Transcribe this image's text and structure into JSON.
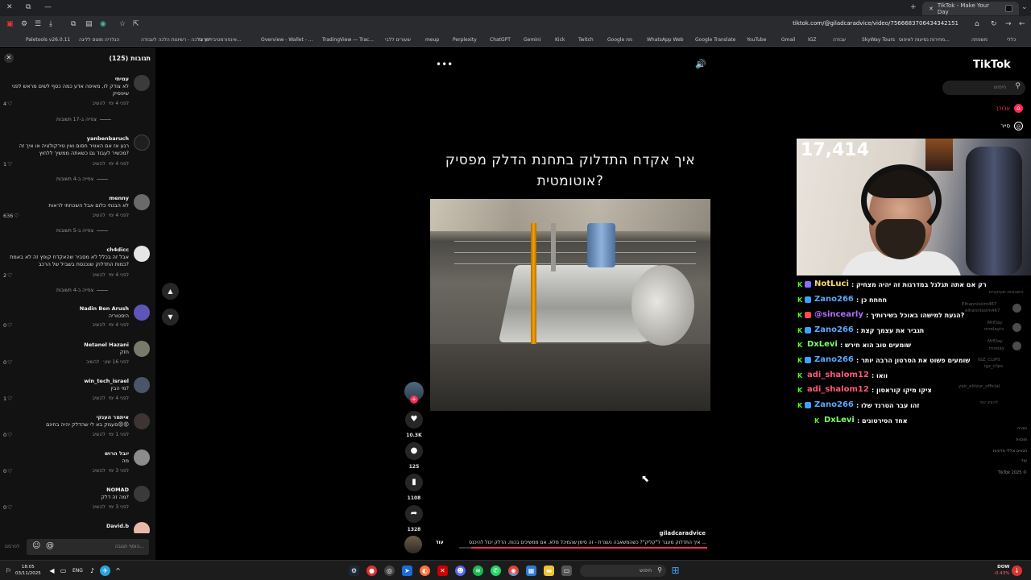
{
  "browser": {
    "tab_title": "TikTok - Make Your Day",
    "url": "tiktok.com/@giladcaradvice/video/7566683706434342151",
    "bookmarks": [
      "Paletools v26.0.11",
      "הגלריה מוטס לליגה",
      "דרך ברכה - רשיונות הלכה לעבודה",
      "אינפורמטיבי ישראל...",
      "Overview - Wallet - ...",
      "TradingView — Trac...",
      "שעורים ללבי",
      "meup",
      "Perplexity",
      "ChatGPT",
      "Gemini",
      "Kick",
      "Twitch",
      "Google מת",
      "WhatsApp Web",
      "Google Translate",
      "YouTube",
      "Gmail",
      "IGZ",
      "עבודה",
      "SkyWay Tours",
      "מחירות נסיעות לאיפוס...",
      "משפחה",
      "כללי"
    ]
  },
  "comments": {
    "title": "תגובות (125)",
    "send_hint": "לפרסם",
    "input_placeholder": "הוסף תגובה...",
    "items": [
      {
        "user": "עמיתי",
        "text": "לא צודק לו, מאיפה אדע כמה כסף לשים מראש לפני שיפסיק",
        "time": "לפני 4 ימי",
        "reply": "להשיב",
        "likes": "4",
        "replies": "צפייה ב-17 תשובות"
      },
      {
        "user": "yanbenbaruch",
        "text": "רגע אז אם האוויר חסום ואין טירקולציה או איך זה מכשיר לעבוד גם כשאתה ממשיך ללחוץ?",
        "time": "לפני 4 ימי",
        "reply": "להשיב",
        "likes": "1",
        "replies": "צפייה ב-4 תשובות"
      },
      {
        "user": "menny",
        "text": "לא הבנתי כלום אבל השכחתי לראות",
        "time": "לפני 4 ימי",
        "reply": "להשיב",
        "likes": "636",
        "replies": "צפייה ב-5 תשובות"
      },
      {
        "user": "ch4dicc",
        "text": "אבל זה בכלל לא מסביר שהאקדח קופץ זה לא באמת כמות התדלוק שנכנסת בשביל של הרכב?",
        "time": "לפני 4 ימי",
        "reply": "להשיב",
        "likes": "2",
        "replies": "צפייה ב-4 תשובות"
      },
      {
        "user": "Nadin Ben Arush",
        "text": "היסטוריה",
        "time": "לפני 4 ימי",
        "reply": "להשיב",
        "likes": "0",
        "replies": ""
      },
      {
        "user": "Netanel Hazani",
        "text": "חזק",
        "time": "לפני 16 שע׳",
        "reply": "להשיב",
        "likes": "0",
        "replies": ""
      },
      {
        "user": "win_tech_israel",
        "text": "מי הבין?",
        "time": "לפני 4 ימי",
        "reply": "להשיב",
        "likes": "1",
        "replies": ""
      },
      {
        "user": "איתמר הענקי",
        "text": "סעמק בא לי שהדלק יהיה בחינם😡😡",
        "time": "לפני 1 ימי",
        "reply": "להשיב",
        "likes": "0",
        "replies": ""
      },
      {
        "user": "יובל הרוש",
        "text": "מה",
        "time": "לפני 3 ימי",
        "reply": "להשיב",
        "likes": "0",
        "replies": ""
      },
      {
        "user": "NOMAD",
        "text": "מה זה דלק?",
        "time": "לפני 3 ימי",
        "reply": "להשיב",
        "likes": "0",
        "replies": ""
      },
      {
        "user": "David.b",
        "text": "",
        "time": "",
        "reply": "",
        "likes": "",
        "replies": ""
      }
    ]
  },
  "video": {
    "title": "איך אקדח התדלוק בתחנת הדלק מפסיק אוטומטית?",
    "author": "giladcaradvice",
    "description": "איך התדלוק מעבר ל\"קליק\"? כשהמשאבה נעצרת - זה סימן שהמיכל מלא. אם ממשיכים בכוח, הדלק יכול להיכנס ...",
    "more_label": "עוד",
    "likes": "10.3K",
    "comments_count": "125",
    "saves": "1108",
    "shares": "1328",
    "progress": 0.95
  },
  "tiktok": {
    "logo": "TikTok",
    "search_placeholder": "חיפוש",
    "nav": [
      {
        "label": "עבורך",
        "color": "#fe2c55"
      },
      {
        "label": "סייר",
        "color": "#ffffff"
      }
    ],
    "footer": [
      "חברה",
      "תוכנית",
      "תנאים וכללי מדיניות",
      "עוד",
      "TikTok 2025 ©"
    ]
  },
  "stream": {
    "viewer_count": "17,414",
    "chat": [
      {
        "user": "NotLuci",
        "msg": ": רק אם אתה תגלגל במדרגות זה יהיה מצחיק",
        "color": "#f5d76e",
        "badge2": "#8a6cff"
      },
      {
        "user": "Zano266",
        "msg": ": חחחח כן",
        "color": "#5ba8ff",
        "badge2": "#3fa0ff"
      },
      {
        "user": "@sincearly",
        "msg": ": הגעת למישהו באוכל בשירותיך?",
        "color": "#b86bff",
        "badge2": "#ff4b4b"
      },
      {
        "user": "Zano266",
        "msg": ": תגביר את עצמך קצת",
        "color": "#5ba8ff",
        "badge2": "#3fa0ff"
      },
      {
        "user": "DxLevi",
        "msg": ": שומעים טוב הוא חירש",
        "color": "#7cff6b",
        "badge2": ""
      },
      {
        "user": "Zano266",
        "msg": ": שומעים פשוט את הסרטון הרבה יותר",
        "color": "#5ba8ff",
        "badge2": "#3fa0ff"
      },
      {
        "user": "adi_shalom12",
        "msg": ": וואו",
        "color": "#ff5a7a",
        "badge2": ""
      },
      {
        "user": "adi_shalom12",
        "msg": ": ציקו מיקו קוראסון",
        "color": "#ff5a7a",
        "badge2": ""
      },
      {
        "user": "Zano266",
        "msg": ": זהו עבר הטרנד שלו",
        "color": "#5ba8ff",
        "badge2": "#3fa0ff"
      },
      {
        "user": "DxLevi",
        "msg": ": אחד הסירטונים",
        "color": "#7cff6b",
        "badge2": ""
      }
    ],
    "ghost_labels": [
      "חשבונות שעוקבים",
      "Elhannissim467",
      "elhannissim467",
      "MrElay",
      "mrelaytv",
      "MrElay",
      "mrelay",
      "IGZ_CLIPS",
      "igz_clips",
      "yair_elitzur_official",
      "להציג עוד"
    ]
  },
  "taskbar": {
    "time": "18:05",
    "date": "03/11/2025",
    "lang": "ENG",
    "search_placeholder": "חיפוש",
    "stock_name": "DOW",
    "stock_change": "-0.43%"
  }
}
